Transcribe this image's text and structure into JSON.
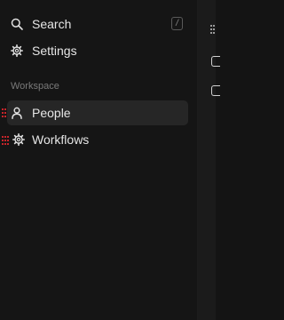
{
  "sidebar": {
    "search": {
      "label": "Search",
      "shortcut": "/",
      "icon": "search-icon"
    },
    "settings": {
      "label": "Settings",
      "icon": "gear-icon"
    },
    "section_label": "Workspace",
    "items": [
      {
        "label": "People",
        "icon": "person-icon",
        "active": true
      },
      {
        "label": "Workflows",
        "icon": "workflow-gear-icon",
        "active": false
      }
    ]
  },
  "colors": {
    "background": "#141414",
    "active_item": "#262626",
    "text": "#e6e6e6",
    "muted": "#7a7a7a",
    "drag_handle": "#c8242a"
  }
}
